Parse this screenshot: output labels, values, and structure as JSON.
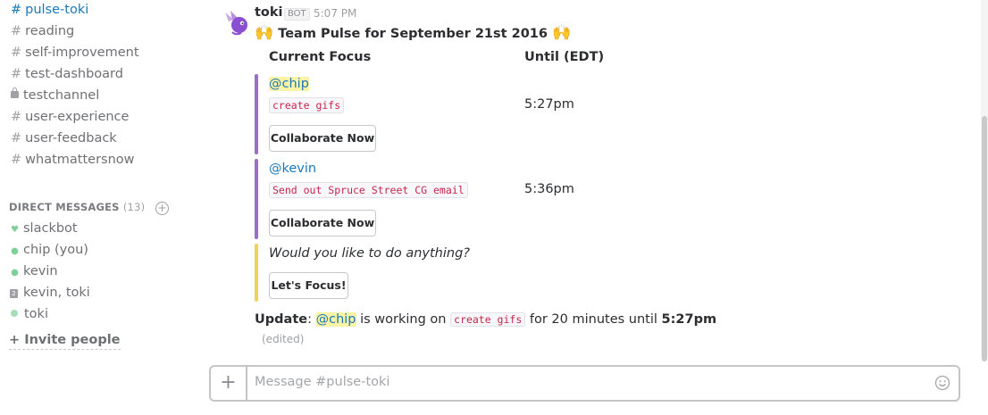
{
  "sidebar": {
    "channels": [
      {
        "name": "pulse-toki",
        "type": "hash",
        "active": true
      },
      {
        "name": "reading",
        "type": "hash",
        "active": false
      },
      {
        "name": "self-improvement",
        "type": "hash",
        "active": false
      },
      {
        "name": "test-dashboard",
        "type": "hash",
        "active": false
      },
      {
        "name": "testchannel",
        "type": "lock",
        "active": false
      },
      {
        "name": "user-experience",
        "type": "hash",
        "active": false
      },
      {
        "name": "user-feedback",
        "type": "hash",
        "active": false
      },
      {
        "name": "whatmattersnow",
        "type": "hash",
        "active": false
      }
    ],
    "hash_symbol": "#",
    "dm_header": {
      "label": "DIRECT MESSAGES",
      "count": "(13)"
    },
    "dm_add_symbol": "+",
    "direct_messages": [
      {
        "name": "slackbot",
        "icon": "heart-icon"
      },
      {
        "name": "chip (you)",
        "icon": "presence-active-icon"
      },
      {
        "name": "kevin",
        "icon": "presence-active-icon"
      },
      {
        "name": "kevin, toki",
        "icon": "group-dm-icon"
      },
      {
        "name": "toki",
        "icon": "presence-dot-icon"
      }
    ],
    "group_dm_count": "2",
    "invite": "+ Invite people"
  },
  "message": {
    "sender": "toki",
    "bot_tag": "BOT",
    "time": "5:07 PM",
    "emoji": "🙌",
    "headline": "Team Pulse for September 21st 2016",
    "columns": {
      "focus": "Current Focus",
      "until": "Until (EDT)"
    },
    "attachments": [
      {
        "mention": "@chip",
        "task": "create gifs",
        "until": "5:27pm",
        "button": "Collaborate Now"
      },
      {
        "mention": "@kevin",
        "task": "Send out Spruce Street CG email",
        "until": "5:36pm",
        "button": "Collaborate Now"
      }
    ],
    "prompt": {
      "question": "Would you like to do anything?",
      "button": "Let's Focus!"
    },
    "update": {
      "label": "Update",
      "colon": ":",
      "mention": "@chip",
      "text1": " is working on ",
      "task": "create gifs",
      "text2": " for 20 minutes until ",
      "until": "5:27pm"
    },
    "edited": "(edited)"
  },
  "composer": {
    "plus": "+",
    "placeholder": "Message #pulse-toki"
  },
  "colors": {
    "accent_purple": "#9a6fc9",
    "accent_yellow": "#f0d25a",
    "link_blue": "#1b78b8",
    "code_red": "#c7254e"
  }
}
